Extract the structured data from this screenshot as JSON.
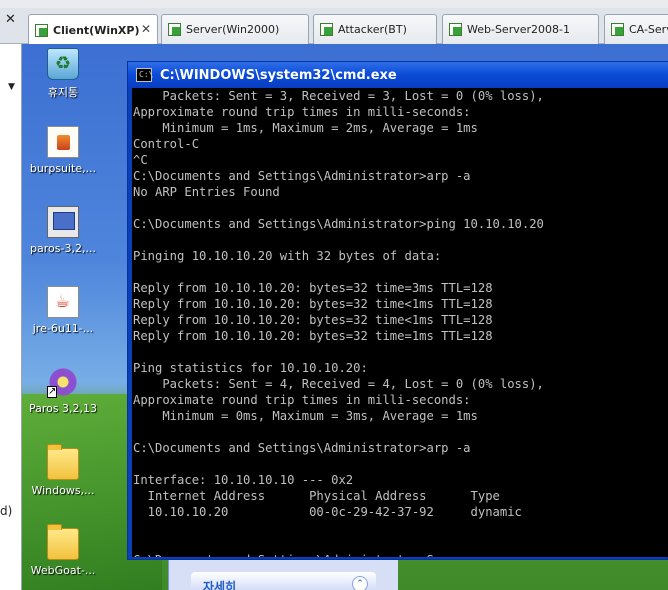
{
  "host": {
    "close_glyph": "✕",
    "dropdown_glyph": "▼",
    "left_fragment": "d)"
  },
  "tabs": [
    {
      "label": "Client(WinXP)",
      "active": true,
      "close": "✕"
    },
    {
      "label": "Server(Win2000)",
      "active": false
    },
    {
      "label": "Attacker(BT)",
      "active": false
    },
    {
      "label": "Web-Server2008-1",
      "active": false
    },
    {
      "label": "CA-Serv",
      "active": false
    }
  ],
  "desktop_icons": [
    {
      "label": "휴지통",
      "icon": "recycle-bin-icon"
    },
    {
      "label": "burpsuite,...",
      "icon": "burpsuite-icon"
    },
    {
      "label": "paros-3,2,...",
      "icon": "paros-installer-icon"
    },
    {
      "label": "jre-6u11-...",
      "icon": "java-icon"
    },
    {
      "label": "Paros 3,2,13",
      "icon": "paros-shortcut-icon"
    },
    {
      "label": "Windows,...",
      "icon": "folder-icon"
    },
    {
      "label": "WebGoat-...",
      "icon": "folder-icon"
    }
  ],
  "explorer": {
    "title": "자세히",
    "collapse_glyph": "⌃"
  },
  "cmd": {
    "title": "C:\\WINDOWS\\system32\\cmd.exe",
    "icon_text": "C:\\",
    "lines": [
      "    Packets: Sent = 3, Received = 3, Lost = 0 (0% loss),",
      "Approximate round trip times in milli-seconds:",
      "    Minimum = 1ms, Maximum = 2ms, Average = 1ms",
      "Control-C",
      "^C",
      "C:\\Documents and Settings\\Administrator>arp -a",
      "No ARP Entries Found",
      "",
      "C:\\Documents and Settings\\Administrator>ping 10.10.10.20",
      "",
      "Pinging 10.10.10.20 with 32 bytes of data:",
      "",
      "Reply from 10.10.10.20: bytes=32 time=3ms TTL=128",
      "Reply from 10.10.10.20: bytes=32 time<1ms TTL=128",
      "Reply from 10.10.10.20: bytes=32 time<1ms TTL=128",
      "Reply from 10.10.10.20: bytes=32 time=1ms TTL=128",
      "",
      "Ping statistics for 10.10.10.20:",
      "    Packets: Sent = 4, Received = 4, Lost = 0 (0% loss),",
      "Approximate round trip times in milli-seconds:",
      "    Minimum = 0ms, Maximum = 3ms, Average = 1ms",
      "",
      "C:\\Documents and Settings\\Administrator>arp -a",
      "",
      "Interface: 10.10.10.10 --- 0x2",
      "  Internet Address      Physical Address      Type",
      "  10.10.10.20           00-0c-29-42-37-92     dynamic",
      "",
      "",
      "C:\\Documents and Settings\\Administrator>S"
    ]
  }
}
